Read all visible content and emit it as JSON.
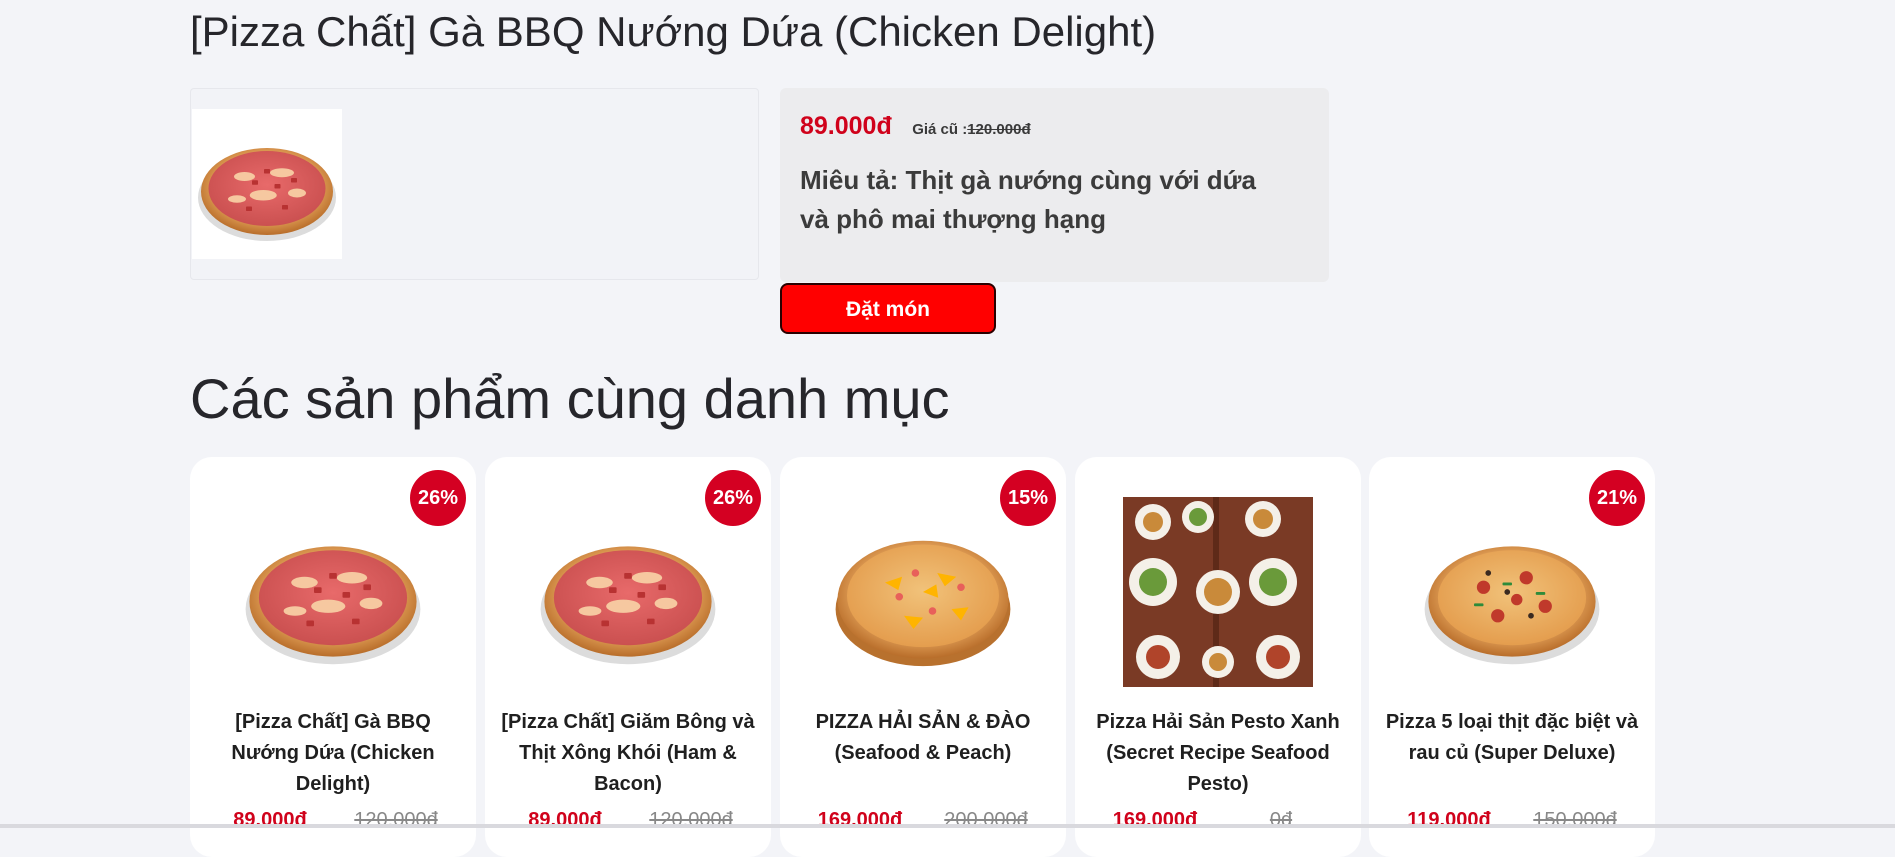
{
  "product": {
    "title": "[Pizza Chất] Gà BBQ Nướng Dứa (Chicken Delight)",
    "image_icon": "pizza-chicken-bacon-image",
    "price": "89.000đ",
    "old_price_label": "Giá cũ :",
    "old_price": "120.000đ",
    "description": "Miêu tả: Thịt gà nướng cùng với dứa và phô mai thượng hạng",
    "order_button": "Đặt món"
  },
  "related": {
    "title": "Các sản phẩm cùng danh mục",
    "items": [
      {
        "name": "[Pizza Chất] Gà BBQ Nướng Dứa (Chicken Delight)",
        "discount": "26%",
        "price": "89.000đ",
        "old_price": "120.000đ",
        "image_icon": "pizza-chicken-bacon-image"
      },
      {
        "name": "[Pizza Chất] Giăm Bông và Thịt Xông Khói (Ham & Bacon)",
        "discount": "26%",
        "price": "89.000đ",
        "old_price": "120.000đ",
        "image_icon": "pizza-ham-bacon-image"
      },
      {
        "name": "PIZZA HẢI SẢN & ĐÀO (Seafood & Peach)",
        "discount": "15%",
        "price": "169.000đ",
        "old_price": "200.000đ",
        "image_icon": "pizza-seafood-peach-image"
      },
      {
        "name": "Pizza Hải Sản Pesto Xanh (Secret Recipe Seafood Pesto)",
        "discount": "",
        "price": "169.000đ",
        "old_price": "0đ",
        "image_icon": "dishes-table-photo"
      },
      {
        "name": "Pizza 5 loại thịt đặc biệt và rau củ (Super Deluxe)",
        "discount": "21%",
        "price": "119.000đ",
        "old_price": "150.000đ",
        "image_icon": "pizza-super-deluxe-image"
      }
    ]
  },
  "colors": {
    "accent_red": "#d0021b",
    "button_red": "#ff0000",
    "badge_red": "#d40022",
    "background": "#f3f4f8"
  }
}
